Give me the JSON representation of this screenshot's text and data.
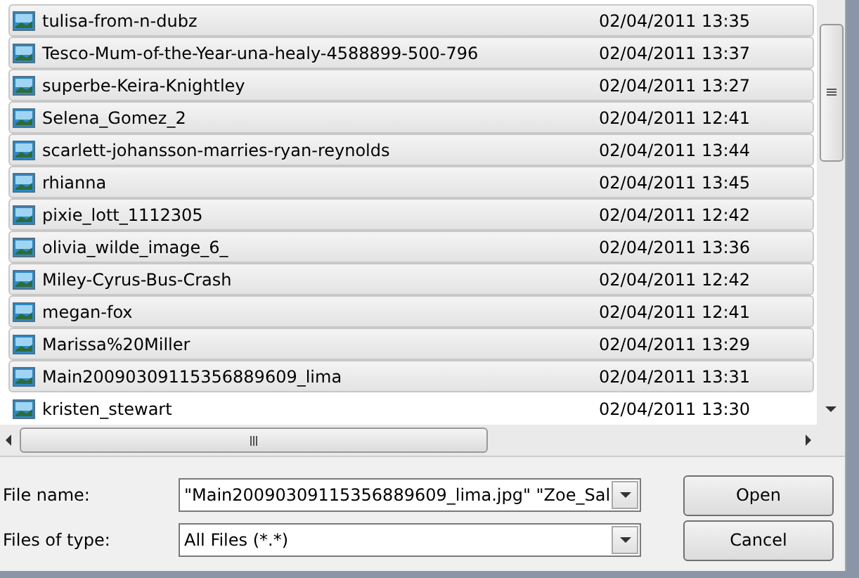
{
  "files": [
    {
      "name": "tulisa-from-n-dubz",
      "date": "02/04/2011 13:35",
      "selected": true
    },
    {
      "name": "Tesco-Mum-of-the-Year-una-healy-4588899-500-796",
      "date": "02/04/2011 13:37",
      "selected": true
    },
    {
      "name": "superbe-Keira-Knightley",
      "date": "02/04/2011 13:27",
      "selected": true
    },
    {
      "name": "Selena_Gomez_2",
      "date": "02/04/2011 12:41",
      "selected": true
    },
    {
      "name": "scarlett-johansson-marries-ryan-reynolds",
      "date": "02/04/2011 13:44",
      "selected": true
    },
    {
      "name": "rhianna",
      "date": "02/04/2011 13:45",
      "selected": true
    },
    {
      "name": "pixie_lott_1112305",
      "date": "02/04/2011 12:42",
      "selected": true
    },
    {
      "name": "olivia_wilde_image_6_",
      "date": "02/04/2011 13:36",
      "selected": true
    },
    {
      "name": "Miley-Cyrus-Bus-Crash",
      "date": "02/04/2011 12:42",
      "selected": true
    },
    {
      "name": "megan-fox",
      "date": "02/04/2011 12:41",
      "selected": true
    },
    {
      "name": "Marissa%20Miller",
      "date": "02/04/2011 13:29",
      "selected": true
    },
    {
      "name": "Main20090309115356889609_lima",
      "date": "02/04/2011 13:31",
      "selected": true
    },
    {
      "name": "kristen_stewart",
      "date": "02/04/2011 13:30",
      "selected": false
    }
  ],
  "file_name": {
    "label": "File name:",
    "value": "\"Main20090309115356889609_lima.jpg\" \"Zoe_Sal"
  },
  "file_type": {
    "label": "Files of type:",
    "value": "All Files (*.*)"
  },
  "buttons": [
    "Open",
    "Cancel"
  ]
}
